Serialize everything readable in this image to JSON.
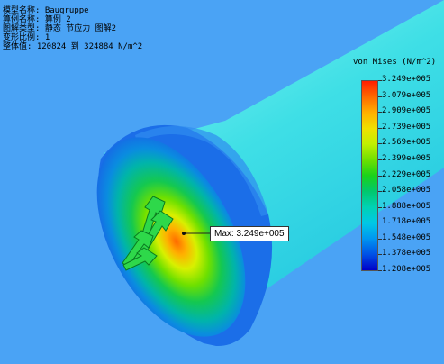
{
  "info": {
    "model_name": "模型名称: Baugruppe",
    "study_name": "算例名称: 算例 2",
    "plot_type": "图解类型: 静态 节应力 图解2",
    "deformation_scale": "变形比例: 1",
    "overall_range": "整体值: 120824 到 324884 N/m^2"
  },
  "legend": {
    "title": "von Mises (N/m^2)",
    "ticks": [
      "3.249e+005",
      "3.079e+005",
      "2.909e+005",
      "2.739e+005",
      "2.569e+005",
      "2.399e+005",
      "2.229e+005",
      "2.058e+005",
      "1.888e+005",
      "1.718e+005",
      "1.548e+005",
      "1.378e+005",
      "1.208e+005"
    ],
    "colors": [
      "#ff1e00",
      "#ff6a00",
      "#ffb000",
      "#f0e000",
      "#c0f000",
      "#6ee000",
      "#1ad21a",
      "#00c86e",
      "#00d2b4",
      "#00c8e6",
      "#0096f0",
      "#0050e6",
      "#0000c8"
    ]
  },
  "callout": {
    "text": "Max: 3.249e+005"
  },
  "colors": {
    "background": "#4aa3f5",
    "shaft": "#33d9e6",
    "rim": "#1878e6",
    "face_hot": "#ff6a00"
  }
}
